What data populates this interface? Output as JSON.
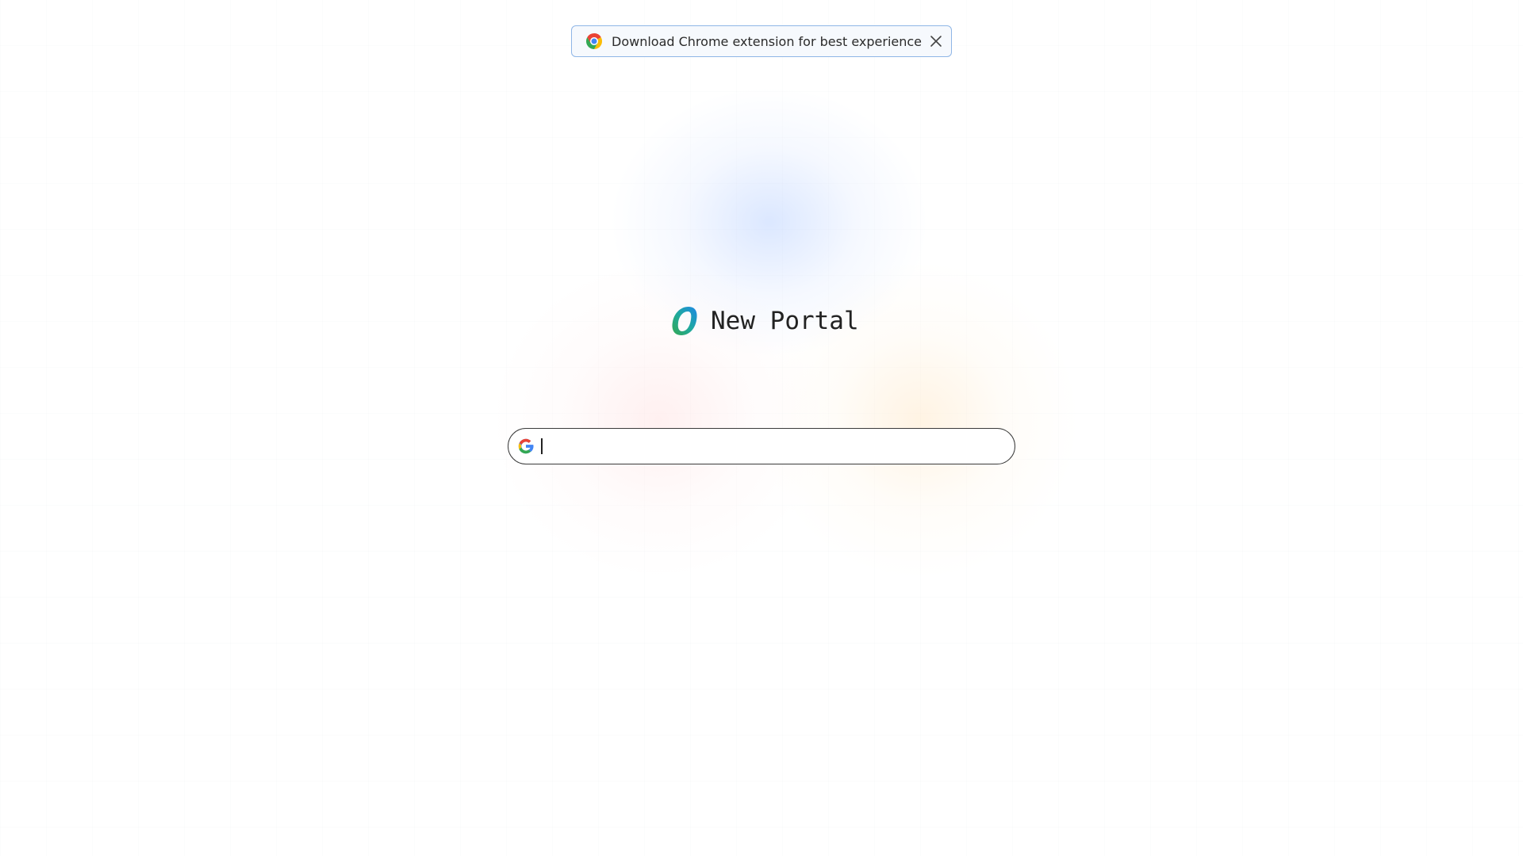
{
  "banner": {
    "text": "Download Chrome extension for best experience",
    "icon": "chrome-icon",
    "close_icon": "close-icon"
  },
  "brand": {
    "name": "New Portal",
    "logo_icon": "portal-logo-icon"
  },
  "search": {
    "value": "",
    "placeholder": "",
    "icon": "google-icon"
  },
  "colors": {
    "banner_border": "#8fb6e6",
    "logo_blue": "#1e88e5",
    "logo_green": "#34a853",
    "search_border": "#3a3a3a"
  }
}
